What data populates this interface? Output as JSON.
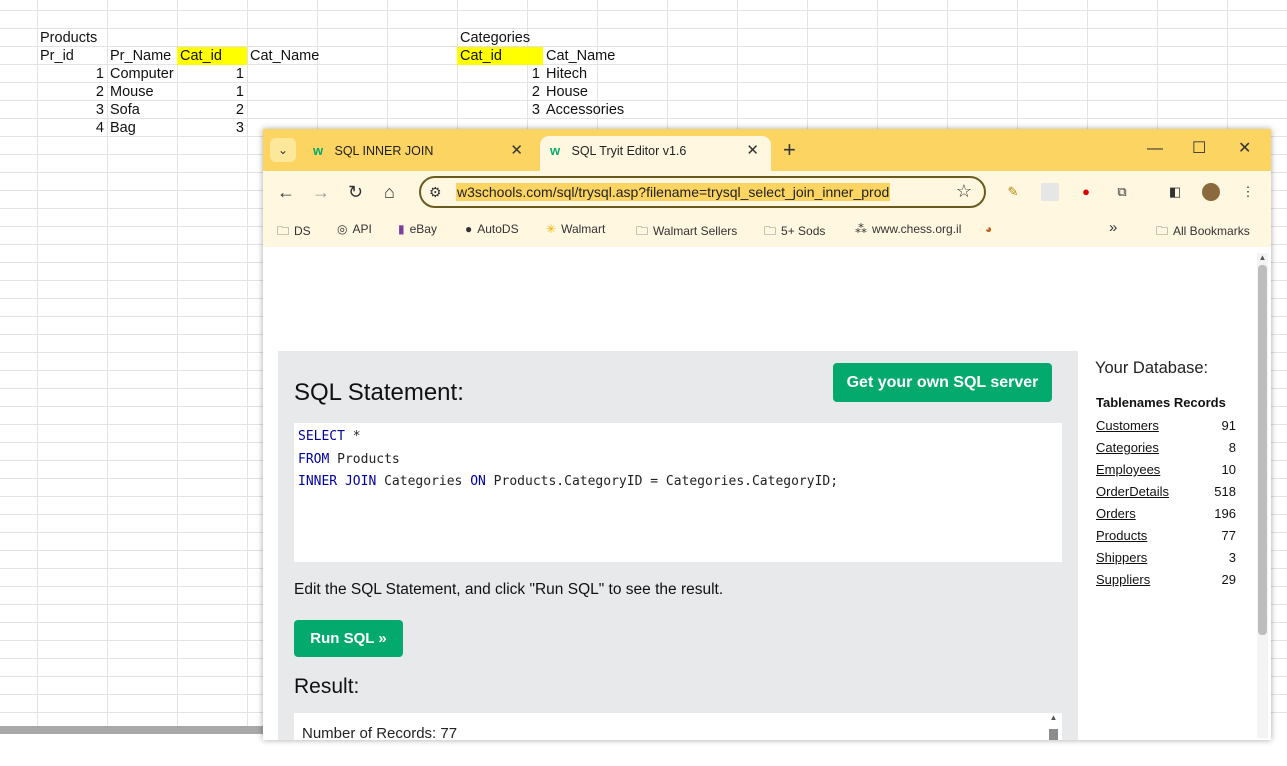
{
  "spreadsheet": {
    "products_title": "Products",
    "products_headers": [
      "Pr_id",
      "Pr_Name",
      "Cat_id",
      "Cat_Name"
    ],
    "products_rows": [
      {
        "id": "1",
        "name": "Computer",
        "cat": "1"
      },
      {
        "id": "2",
        "name": "Mouse",
        "cat": "1"
      },
      {
        "id": "3",
        "name": "Sofa",
        "cat": "2"
      },
      {
        "id": "4",
        "name": "Bag",
        "cat": "3"
      }
    ],
    "categories_title": "Categories",
    "categories_headers": [
      "Cat_id",
      "Cat_Name"
    ],
    "categories_rows": [
      {
        "id": "1",
        "name": "Hitech"
      },
      {
        "id": "2",
        "name": "House"
      },
      {
        "id": "3",
        "name": "Accessories"
      }
    ],
    "highlight_color": "#ffff00"
  },
  "browser": {
    "tabs": [
      {
        "label": "SQL INNER JOIN",
        "icon": "w3schools-favicon"
      },
      {
        "label": "SQL Tryit Editor v1.6",
        "icon": "w3schools-favicon"
      }
    ],
    "url": "w3schools.com/sql/trysql.asp?filename=trysql_select_join_inner_prod",
    "accent_color": "#fbd461",
    "bookmarks": [
      {
        "label": "DS",
        "icon": "folder-icon"
      },
      {
        "label": "API",
        "icon": "api-icon"
      },
      {
        "label": "eBay",
        "icon": "ebay-icon"
      },
      {
        "label": "AutoDS",
        "icon": "autods-icon"
      },
      {
        "label": "Walmart",
        "icon": "walmart-icon"
      },
      {
        "label": "Walmart Sellers",
        "icon": "folder-icon"
      },
      {
        "label": "5+ Sods",
        "icon": "folder-icon"
      },
      {
        "label": "www.chess.org.il",
        "icon": "chess-icon"
      }
    ],
    "all_bookmarks": "All Bookmarks"
  },
  "page": {
    "own_server_button": "Get your own SQL server",
    "sql_title": "SQL Statement:",
    "sql_lines": [
      {
        "kw": "SELECT",
        "rest": " *"
      },
      {
        "kw": "FROM",
        "rest": " Products"
      },
      {
        "kw": "INNER JOIN",
        "rest": " Categories ",
        "kw2": "ON",
        "rest2": " Products.CategoryID = Categories.CategoryID;"
      }
    ],
    "instructions": "Edit the SQL Statement, and click \"Run SQL\" to see the result.",
    "run_button": "Run SQL »",
    "result_title": "Result:",
    "record_count": "Number of Records: 77",
    "brand_color": "#04aa6d",
    "database": {
      "title": "Your Database:",
      "col_tablenames": "Tablenames",
      "col_records": "Records",
      "tables": [
        {
          "name": "Customers",
          "records": "91"
        },
        {
          "name": "Categories",
          "records": "8"
        },
        {
          "name": "Employees",
          "records": "10"
        },
        {
          "name": "OrderDetails",
          "records": "518"
        },
        {
          "name": "Orders",
          "records": "196"
        },
        {
          "name": "Products",
          "records": "77"
        },
        {
          "name": "Shippers",
          "records": "3"
        },
        {
          "name": "Suppliers",
          "records": "29"
        }
      ]
    }
  }
}
